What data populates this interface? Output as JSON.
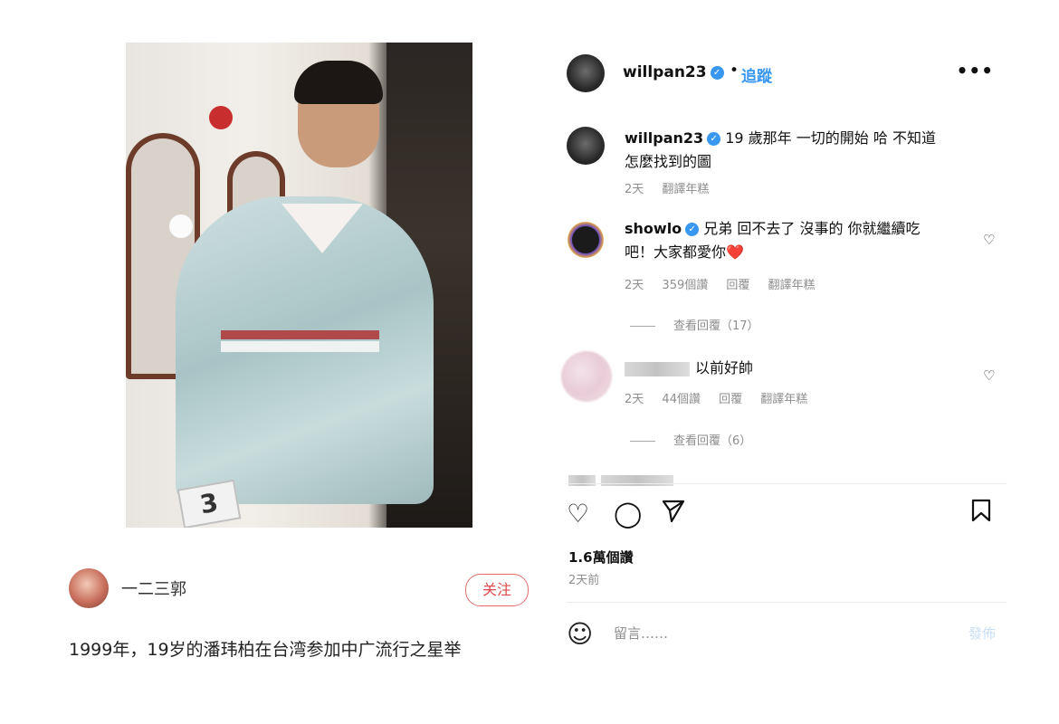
{
  "left": {
    "author_name": "一二三郭",
    "follow_label": "关注",
    "article_text": "1999年，19岁的潘玮柏在台湾参加中广流行之星举",
    "photo_tag": "3"
  },
  "post": {
    "header": {
      "username": "willpan23",
      "dot": "•",
      "follow_label": "追蹤",
      "more_label": "•••"
    },
    "caption": {
      "username": "willpan23",
      "text": "19 歲那年 一切的開始 哈 不知道怎麼找到的圖",
      "time": "2天",
      "translate": "翻譯年糕"
    },
    "comments": [
      {
        "username": "showlo",
        "text": "兄弟 回不去了 沒事的 你就繼續吃吧！大家都愛你❤️",
        "time": "2天",
        "likes": "359個讚",
        "reply": "回覆",
        "translate": "翻譯年糕",
        "view_replies": "查看回覆（17）"
      },
      {
        "username": "",
        "text": "以前好帥",
        "time": "2天",
        "likes": "44個讚",
        "reply": "回覆",
        "translate": "翻譯年糕",
        "view_replies": "查看回覆（6）"
      }
    ],
    "likes_total": "1.6萬個讚",
    "posted_time": "2天前",
    "comment_placeholder": "留言……",
    "post_label": "發佈"
  }
}
